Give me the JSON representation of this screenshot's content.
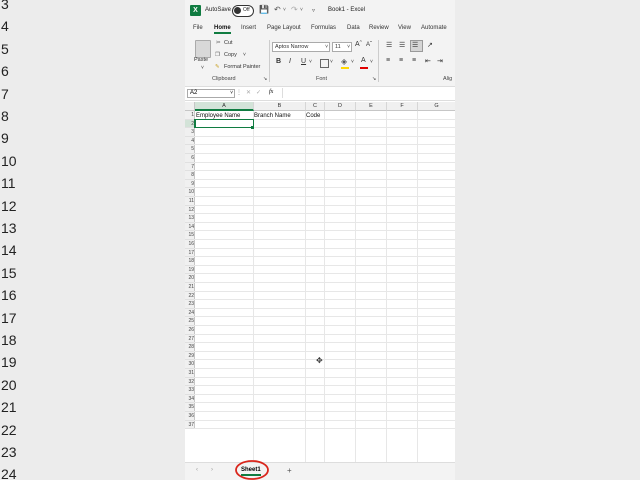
{
  "left_row_numbers": [
    "3",
    "4",
    "5",
    "6",
    "7",
    "8",
    "9",
    "10",
    "11",
    "12",
    "13",
    "14",
    "15",
    "16",
    "17",
    "18",
    "19",
    "20",
    "21",
    "22",
    "23",
    "24"
  ],
  "titlebar": {
    "autosave": "AutoSave",
    "toggle": "Off",
    "doc_title": "Book1 - Excel"
  },
  "tabs": [
    "File",
    "Home",
    "Insert",
    "Page Layout",
    "Formulas",
    "Data",
    "Review",
    "View",
    "Automate"
  ],
  "ribbon": {
    "paste": "Paste",
    "cut": "Cut",
    "copy": "Copy",
    "format_painter": "Format Painter",
    "clipboard_label": "Clipboard",
    "font_label": "Font",
    "align_label": "Alig",
    "font_name": "Aptos Narrow",
    "font_size": "11",
    "bold": "B",
    "italic": "I",
    "underline": "U"
  },
  "formula_bar": {
    "name_box": "A2",
    "fx": "fx",
    "value": ""
  },
  "columns": [
    "A",
    "B",
    "C",
    "D",
    "E",
    "F",
    "G"
  ],
  "rows": [
    "1",
    "2",
    "3",
    "4",
    "5",
    "6",
    "7",
    "8",
    "9",
    "10",
    "11",
    "12",
    "13",
    "14",
    "15",
    "16",
    "17",
    "18",
    "19",
    "20",
    "21",
    "22",
    "23",
    "24",
    "25",
    "26",
    "27",
    "28",
    "29",
    "30",
    "31",
    "32",
    "33",
    "34",
    "35",
    "36",
    "37"
  ],
  "cells": {
    "A1": "Employee Name",
    "B1": "Branch Name",
    "C1": "Code"
  },
  "sheet_tabs": [
    "Sheet1"
  ],
  "colors": {
    "accent": "#107c41",
    "annotation": "#d9261c"
  }
}
